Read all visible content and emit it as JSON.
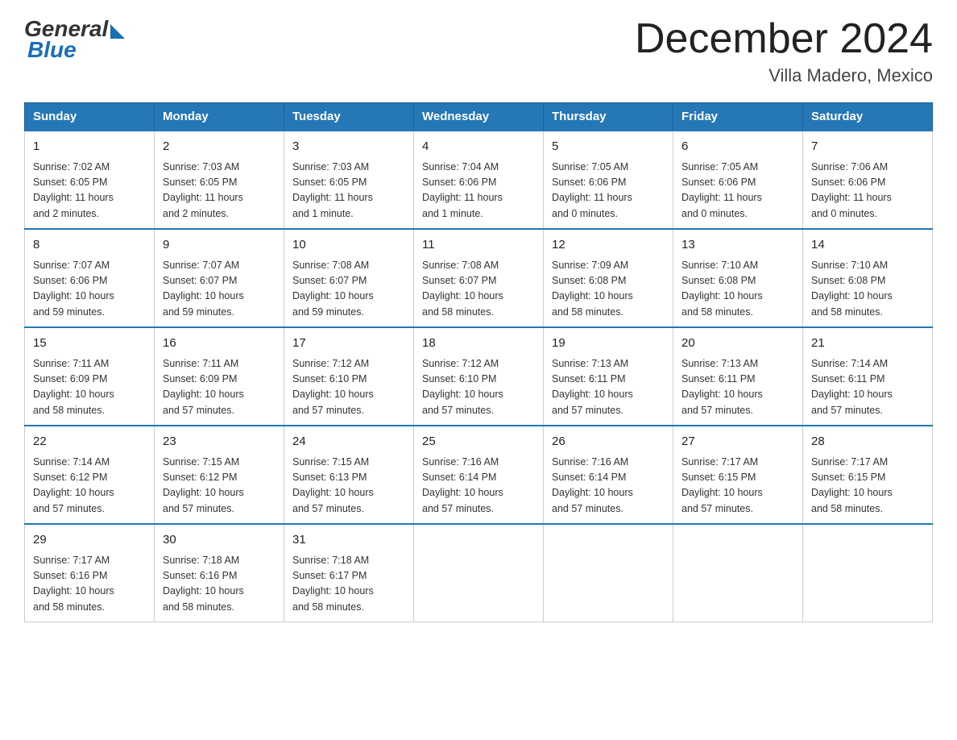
{
  "logo": {
    "general": "General",
    "blue": "Blue"
  },
  "title": "December 2024",
  "subtitle": "Villa Madero, Mexico",
  "headers": [
    "Sunday",
    "Monday",
    "Tuesday",
    "Wednesday",
    "Thursday",
    "Friday",
    "Saturday"
  ],
  "weeks": [
    [
      {
        "day": "1",
        "info": "Sunrise: 7:02 AM\nSunset: 6:05 PM\nDaylight: 11 hours\nand 2 minutes."
      },
      {
        "day": "2",
        "info": "Sunrise: 7:03 AM\nSunset: 6:05 PM\nDaylight: 11 hours\nand 2 minutes."
      },
      {
        "day": "3",
        "info": "Sunrise: 7:03 AM\nSunset: 6:05 PM\nDaylight: 11 hours\nand 1 minute."
      },
      {
        "day": "4",
        "info": "Sunrise: 7:04 AM\nSunset: 6:06 PM\nDaylight: 11 hours\nand 1 minute."
      },
      {
        "day": "5",
        "info": "Sunrise: 7:05 AM\nSunset: 6:06 PM\nDaylight: 11 hours\nand 0 minutes."
      },
      {
        "day": "6",
        "info": "Sunrise: 7:05 AM\nSunset: 6:06 PM\nDaylight: 11 hours\nand 0 minutes."
      },
      {
        "day": "7",
        "info": "Sunrise: 7:06 AM\nSunset: 6:06 PM\nDaylight: 11 hours\nand 0 minutes."
      }
    ],
    [
      {
        "day": "8",
        "info": "Sunrise: 7:07 AM\nSunset: 6:06 PM\nDaylight: 10 hours\nand 59 minutes."
      },
      {
        "day": "9",
        "info": "Sunrise: 7:07 AM\nSunset: 6:07 PM\nDaylight: 10 hours\nand 59 minutes."
      },
      {
        "day": "10",
        "info": "Sunrise: 7:08 AM\nSunset: 6:07 PM\nDaylight: 10 hours\nand 59 minutes."
      },
      {
        "day": "11",
        "info": "Sunrise: 7:08 AM\nSunset: 6:07 PM\nDaylight: 10 hours\nand 58 minutes."
      },
      {
        "day": "12",
        "info": "Sunrise: 7:09 AM\nSunset: 6:08 PM\nDaylight: 10 hours\nand 58 minutes."
      },
      {
        "day": "13",
        "info": "Sunrise: 7:10 AM\nSunset: 6:08 PM\nDaylight: 10 hours\nand 58 minutes."
      },
      {
        "day": "14",
        "info": "Sunrise: 7:10 AM\nSunset: 6:08 PM\nDaylight: 10 hours\nand 58 minutes."
      }
    ],
    [
      {
        "day": "15",
        "info": "Sunrise: 7:11 AM\nSunset: 6:09 PM\nDaylight: 10 hours\nand 58 minutes."
      },
      {
        "day": "16",
        "info": "Sunrise: 7:11 AM\nSunset: 6:09 PM\nDaylight: 10 hours\nand 57 minutes."
      },
      {
        "day": "17",
        "info": "Sunrise: 7:12 AM\nSunset: 6:10 PM\nDaylight: 10 hours\nand 57 minutes."
      },
      {
        "day": "18",
        "info": "Sunrise: 7:12 AM\nSunset: 6:10 PM\nDaylight: 10 hours\nand 57 minutes."
      },
      {
        "day": "19",
        "info": "Sunrise: 7:13 AM\nSunset: 6:11 PM\nDaylight: 10 hours\nand 57 minutes."
      },
      {
        "day": "20",
        "info": "Sunrise: 7:13 AM\nSunset: 6:11 PM\nDaylight: 10 hours\nand 57 minutes."
      },
      {
        "day": "21",
        "info": "Sunrise: 7:14 AM\nSunset: 6:11 PM\nDaylight: 10 hours\nand 57 minutes."
      }
    ],
    [
      {
        "day": "22",
        "info": "Sunrise: 7:14 AM\nSunset: 6:12 PM\nDaylight: 10 hours\nand 57 minutes."
      },
      {
        "day": "23",
        "info": "Sunrise: 7:15 AM\nSunset: 6:12 PM\nDaylight: 10 hours\nand 57 minutes."
      },
      {
        "day": "24",
        "info": "Sunrise: 7:15 AM\nSunset: 6:13 PM\nDaylight: 10 hours\nand 57 minutes."
      },
      {
        "day": "25",
        "info": "Sunrise: 7:16 AM\nSunset: 6:14 PM\nDaylight: 10 hours\nand 57 minutes."
      },
      {
        "day": "26",
        "info": "Sunrise: 7:16 AM\nSunset: 6:14 PM\nDaylight: 10 hours\nand 57 minutes."
      },
      {
        "day": "27",
        "info": "Sunrise: 7:17 AM\nSunset: 6:15 PM\nDaylight: 10 hours\nand 57 minutes."
      },
      {
        "day": "28",
        "info": "Sunrise: 7:17 AM\nSunset: 6:15 PM\nDaylight: 10 hours\nand 58 minutes."
      }
    ],
    [
      {
        "day": "29",
        "info": "Sunrise: 7:17 AM\nSunset: 6:16 PM\nDaylight: 10 hours\nand 58 minutes."
      },
      {
        "day": "30",
        "info": "Sunrise: 7:18 AM\nSunset: 6:16 PM\nDaylight: 10 hours\nand 58 minutes."
      },
      {
        "day": "31",
        "info": "Sunrise: 7:18 AM\nSunset: 6:17 PM\nDaylight: 10 hours\nand 58 minutes."
      },
      {
        "day": "",
        "info": ""
      },
      {
        "day": "",
        "info": ""
      },
      {
        "day": "",
        "info": ""
      },
      {
        "day": "",
        "info": ""
      }
    ]
  ]
}
